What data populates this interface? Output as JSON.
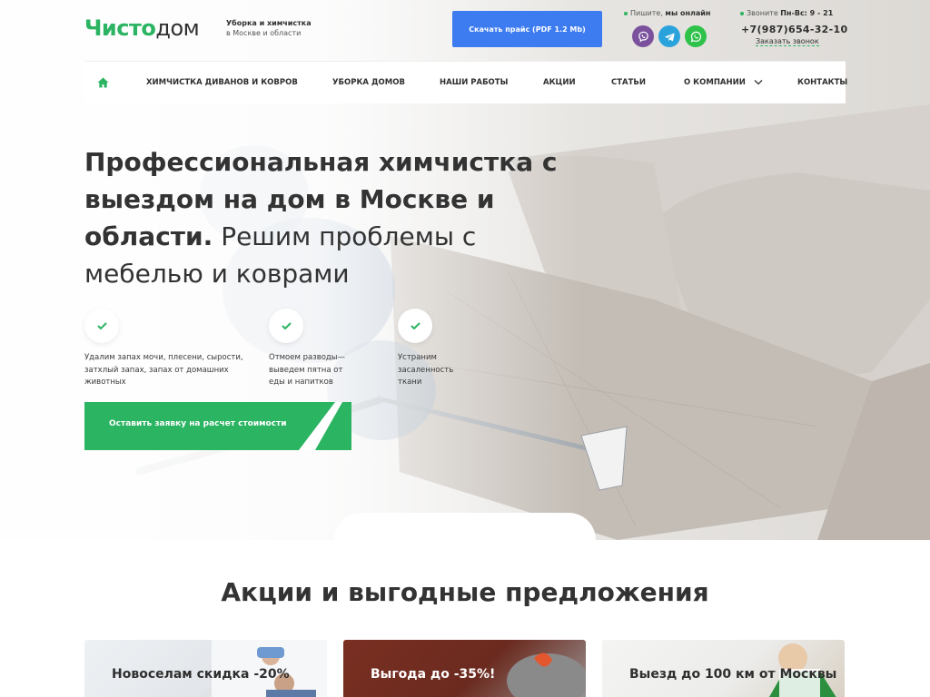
{
  "brand": {
    "logo_part1": "Чисто",
    "logo_part2": "дом",
    "tagline_line1": "Уборка и химчистка",
    "tagline_line2": "в Москве и области",
    "accent_color": "#2bb462",
    "button_blue": "#3d7cf0"
  },
  "header": {
    "price_button": "Скачать прайс (PDF 1.2 Mb)",
    "write_label": "Пишите,",
    "write_status": "мы онлайн",
    "socials": [
      {
        "name": "viber-icon",
        "color": "#7b519d"
      },
      {
        "name": "telegram-icon",
        "color": "#2aa3dc"
      },
      {
        "name": "whatsapp-icon",
        "color": "#2ec24a"
      }
    ],
    "call_label": "Звоните",
    "call_hours": "Пн-Вс: 9 - 21",
    "phone": "+7(987)654-32-10",
    "callback_link": "Заказать звонок"
  },
  "nav": {
    "home_icon": "home-icon",
    "items": [
      {
        "label": "Химчистка диванов и ковров"
      },
      {
        "label": "Уборка домов"
      },
      {
        "label": "Наши работы"
      },
      {
        "label": "Акции"
      },
      {
        "label": "Статьи"
      },
      {
        "label": "О компании"
      },
      {
        "label": "Контакты"
      }
    ]
  },
  "hero": {
    "title_strong": "Профессиональная химчистка с выездом на дом в Москве и области.",
    "title_light": "Решим проблемы с мебелью и коврами",
    "features": [
      {
        "text": "Удалим запах мочи, плесени, сырости, затхлый запах, запах от домашних животных"
      },
      {
        "text": "Отмоем разводы—выведем пятна от еды и напитков"
      },
      {
        "text": "Устраним засаленность ткани"
      }
    ],
    "cta": "Оставить заявку на расчет стоимости"
  },
  "promo": {
    "title": "Акции и выгодные предложения",
    "cards": [
      {
        "text": "Новоселам скидка -20%"
      },
      {
        "text": "Выгода до -35%!"
      },
      {
        "text": "Выезд до 100 км от Москвы"
      }
    ]
  }
}
